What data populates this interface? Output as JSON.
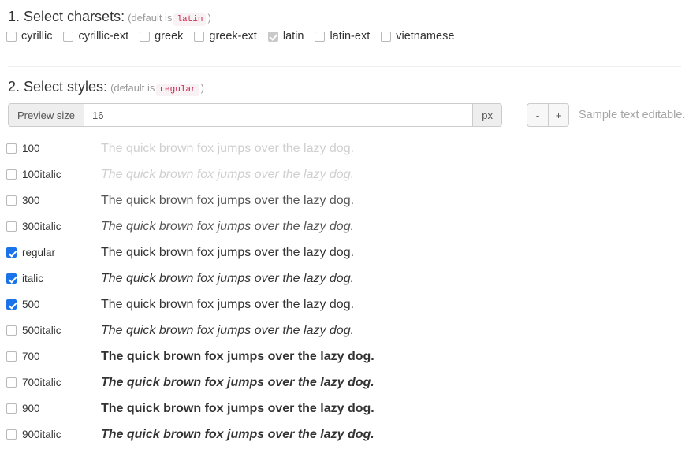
{
  "charsets_section": {
    "index": "1.",
    "title": "1. Select charsets:",
    "note_prefix": "(default is",
    "note_code": "latin",
    "note_suffix": ")",
    "items": [
      {
        "label": "cyrillic",
        "checked": false,
        "disabled": false
      },
      {
        "label": "cyrillic-ext",
        "checked": false,
        "disabled": false
      },
      {
        "label": "greek",
        "checked": false,
        "disabled": false
      },
      {
        "label": "greek-ext",
        "checked": false,
        "disabled": false
      },
      {
        "label": "latin",
        "checked": true,
        "disabled": true
      },
      {
        "label": "latin-ext",
        "checked": false,
        "disabled": false
      },
      {
        "label": "vietnamese",
        "checked": false,
        "disabled": false
      }
    ]
  },
  "styles_section": {
    "title": "2. Select styles:",
    "note_prefix": "(default is",
    "note_code": "regular",
    "note_suffix": ")",
    "preview": {
      "addon_label": "Preview size",
      "value": "16",
      "placeholder": "16",
      "unit_label": "px",
      "decrease_label": "-",
      "increase_label": "+",
      "hint": "Sample text editable."
    },
    "sample_text": "The quick brown fox jumps over the lazy dog.",
    "rows": [
      {
        "label": "100",
        "weight": "100",
        "italic": false,
        "checked": false
      },
      {
        "label": "100italic",
        "weight": "100",
        "italic": true,
        "checked": false
      },
      {
        "label": "300",
        "weight": "300",
        "italic": false,
        "checked": false
      },
      {
        "label": "300italic",
        "weight": "300",
        "italic": true,
        "checked": false
      },
      {
        "label": "regular",
        "weight": "400",
        "italic": false,
        "checked": true
      },
      {
        "label": "italic",
        "weight": "400",
        "italic": true,
        "checked": true
      },
      {
        "label": "500",
        "weight": "500",
        "italic": false,
        "checked": true
      },
      {
        "label": "500italic",
        "weight": "500",
        "italic": true,
        "checked": false
      },
      {
        "label": "700",
        "weight": "700",
        "italic": false,
        "checked": false
      },
      {
        "label": "700italic",
        "weight": "700",
        "italic": true,
        "checked": false
      },
      {
        "label": "900",
        "weight": "900",
        "italic": false,
        "checked": false
      },
      {
        "label": "900italic",
        "weight": "900",
        "italic": true,
        "checked": false
      }
    ]
  },
  "colors": {
    "checked_accent": "#1a73e8",
    "disabled_checkbox": "#c9c9c9",
    "code_text": "#c7254e",
    "code_background": "#f9f2f4",
    "muted_text": "#9a9a9a",
    "divider": "#eeeeee"
  }
}
